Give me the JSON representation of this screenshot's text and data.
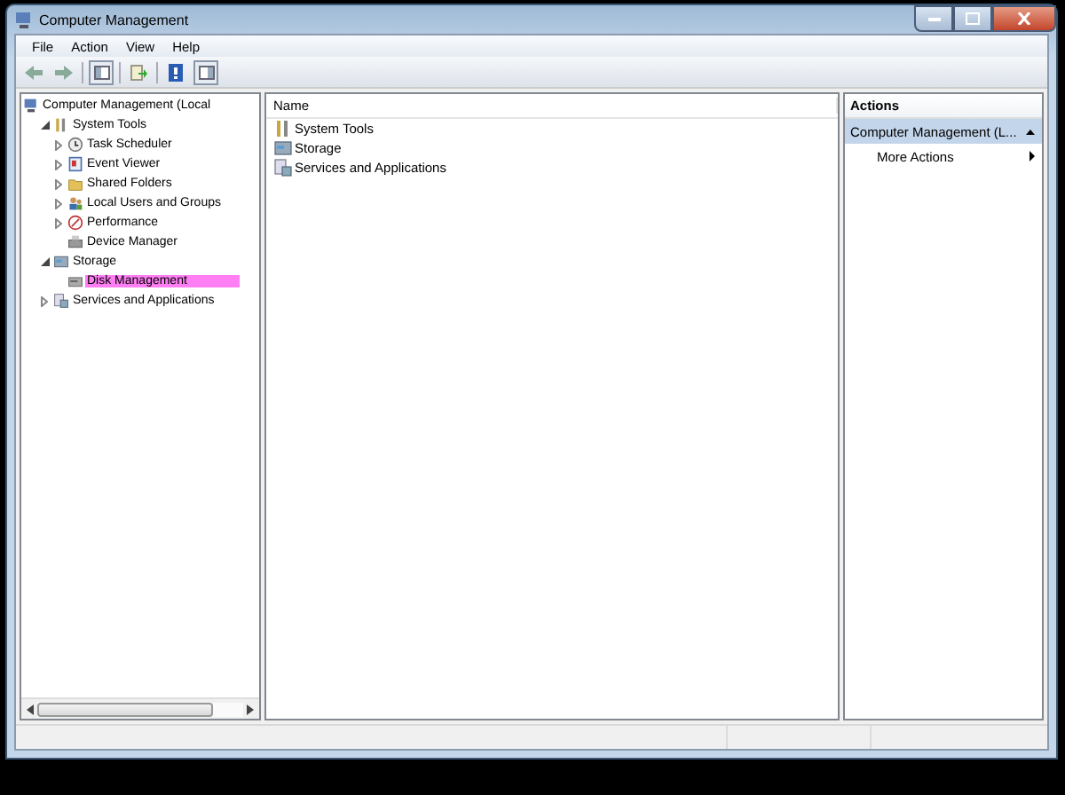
{
  "window": {
    "title": "Computer Management"
  },
  "menu": [
    "File",
    "Action",
    "View",
    "Help"
  ],
  "tree": {
    "label": "Computer Management (Local",
    "selected": false,
    "children": [
      {
        "label": "System Tools",
        "selected": false,
        "expanded": true,
        "children": [
          {
            "label": "Task Scheduler",
            "selected": false,
            "expanded": false
          },
          {
            "label": "Event Viewer",
            "selected": false,
            "expanded": false
          },
          {
            "label": "Shared Folders",
            "selected": false,
            "expanded": false
          },
          {
            "label": "Local Users and Groups",
            "selected": false,
            "expanded": false
          },
          {
            "label": "Performance",
            "selected": false,
            "expanded": false
          },
          {
            "label": "Device Manager",
            "selected": false
          }
        ]
      },
      {
        "label": "Storage",
        "selected": false,
        "expanded": true,
        "children": [
          {
            "label": "Disk Management",
            "selected": true
          }
        ]
      },
      {
        "label": "Services and Applications",
        "selected": false,
        "expanded": false
      }
    ]
  },
  "list": {
    "columns": [
      "Name"
    ],
    "rows": [
      "System Tools",
      "Storage",
      "Services and Applications"
    ]
  },
  "actions": {
    "title": "Actions",
    "section": "Computer Management (L...",
    "items": [
      "More Actions"
    ]
  }
}
